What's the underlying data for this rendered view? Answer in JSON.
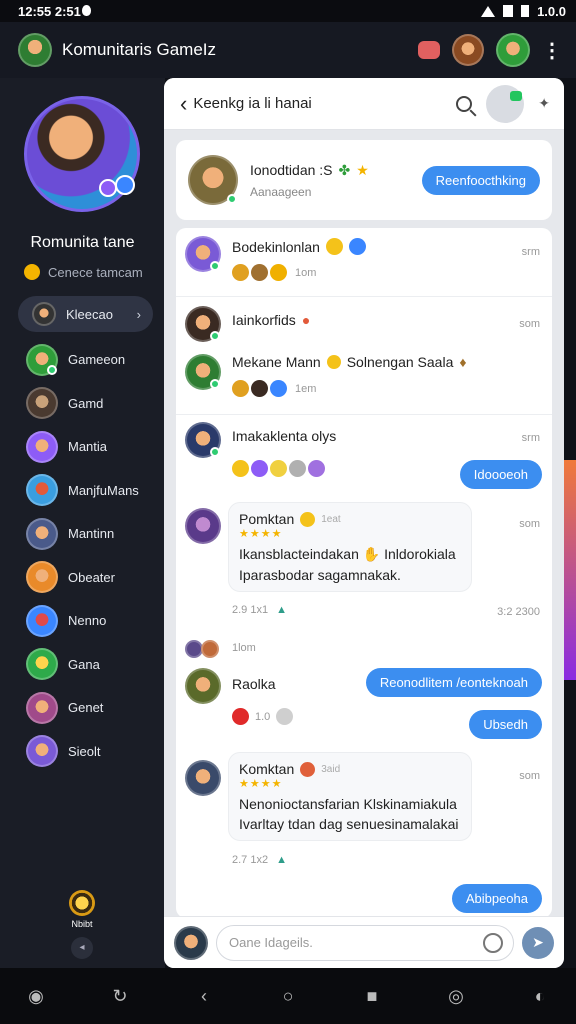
{
  "status_bar": {
    "time": "12:55 2:51",
    "right_text": "1.0.0"
  },
  "app_bar": {
    "title": "Komunitaris GameIz"
  },
  "sidebar": {
    "profile_name": "Romunita tane",
    "profile_sub": "Cenece tamcam",
    "items": [
      {
        "label": "Kleecao",
        "active": true
      },
      {
        "label": "Gameeon"
      },
      {
        "label": "Gamd"
      },
      {
        "label": "Mantia"
      },
      {
        "label": "ManjfuMans"
      },
      {
        "label": "Mantinn"
      },
      {
        "label": "Obeater"
      },
      {
        "label": "Nenno"
      },
      {
        "label": "Gana"
      },
      {
        "label": "Genet"
      },
      {
        "label": "Sieolt"
      }
    ],
    "bottom_label": "Nbibt"
  },
  "panel": {
    "title": "Keenkg ia li hanai",
    "featured": {
      "name": "Ionodtidan :S",
      "sub": "Aanaageen",
      "button": "Reenfoocthking"
    },
    "posts": [
      {
        "name": "Bodekinlonlan",
        "time": "srm",
        "meta": "1om"
      },
      {
        "name": "Iainkorfids",
        "time": "som"
      },
      {
        "name": "Mekane Mann",
        "extra": "Solnengan Saala",
        "meta": "1em"
      },
      {
        "name": "Imakaklenta olys",
        "time": "srm",
        "reply": "Idoooeoh"
      },
      {
        "name": "Pomktan",
        "tag": "1eat",
        "time": "som",
        "text1": "Ikansblacteindakan",
        "text2": "Inldorokiala",
        "text3": "Iparasbodar sagamnakak.",
        "meta": "2.9 1x1",
        "meta_right": "3:2 2300"
      },
      {
        "header_time": "1lom"
      },
      {
        "name": "Raolka",
        "reply": "Reonodlitem /eonteknoah",
        "reply2": "Ubsedh"
      },
      {
        "name": "Komktan",
        "tag": "3aid",
        "time": "som",
        "text1": "Nenonioctansfarian Klskinamiakula",
        "text2": "Ivarltay tdan dag senuesinamalakai",
        "meta": "2.7 1x2",
        "reply": "Abibpeoha"
      }
    ],
    "composer": {
      "placeholder": "Oane Idageils."
    }
  }
}
